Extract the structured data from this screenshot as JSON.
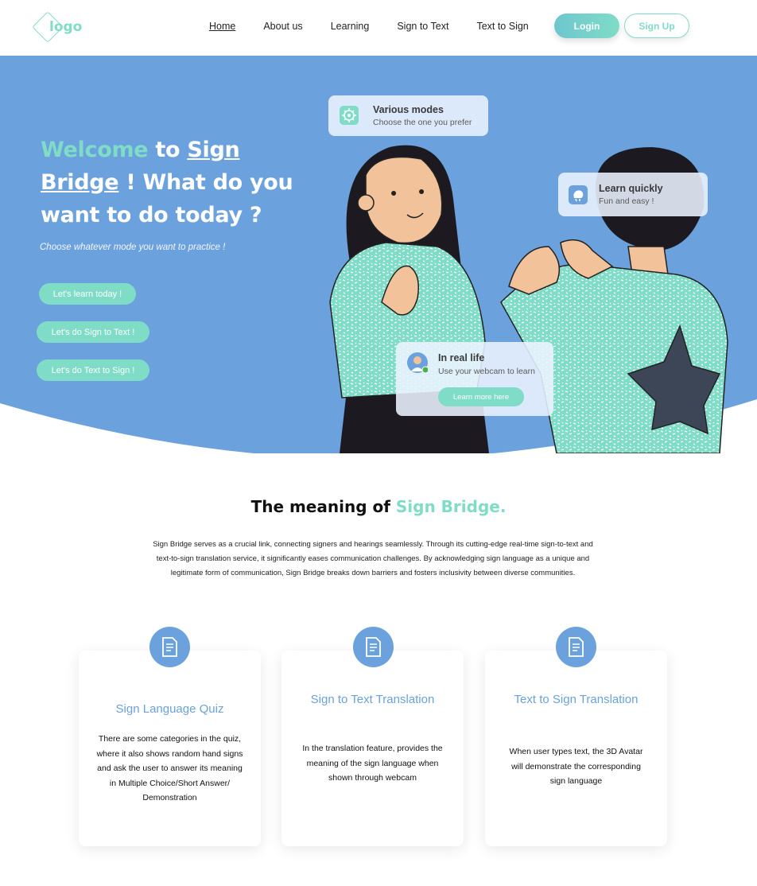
{
  "nav": {
    "logo_text": "logo",
    "links": [
      {
        "label": "Home",
        "active": true
      },
      {
        "label": "About us"
      },
      {
        "label": "Learning"
      },
      {
        "label": "Sign to Text"
      },
      {
        "label": "Text to Sign"
      }
    ],
    "login_label": "Login",
    "signup_label": "Sign Up"
  },
  "hero": {
    "title_welcome": "Welcome",
    "title_to": " to ",
    "title_sign": "Sign",
    "title_bridge": "Bridge",
    "title_rest": " ! What do you want to do today ?",
    "subtitle": "Choose whatever mode you want to practice !",
    "buttons": [
      "Let's learn today !",
      "Let's do Sign to Text !",
      "Let's do Text to Sign !"
    ],
    "cards": {
      "modes": {
        "title": "Various modes",
        "sub": "Choose the one you prefer",
        "icon": "gear-icon"
      },
      "learn": {
        "title": "Learn quickly",
        "sub": "Fun and easy !",
        "icon": "brain-icon"
      },
      "real": {
        "title": "In real life",
        "sub": "Use your webcam to learn",
        "button": "Learn more here",
        "icon": "user-avatar-icon"
      }
    }
  },
  "meaning": {
    "title_prefix": "The meaning of ",
    "title_accent": "Sign Bridge.",
    "text": "Sign Bridge serves as a crucial link, connecting signers and hearings seamlessly. Through its cutting-edge real-time sign-to-text and text-to-sign translation service, it significantly eases communication challenges. By acknowledging sign language as a unique and legitimate form of communication, Sign Bridge breaks down barriers and fosters inclusivity between diverse communities."
  },
  "features": [
    {
      "title": "Sign Language Quiz",
      "text": "There are some categories in the quiz, where it also shows random hand signs and ask the user to answer its meaning in Multiple Choice/Short Answer/ Demonstration",
      "icon": "document-icon"
    },
    {
      "title": "Sign to Text Translation",
      "text": "In the translation feature, provides the meaning of the sign language when shown through webcam",
      "icon": "document-icon"
    },
    {
      "title": "Text to Sign Translation",
      "text": "When user types text, the 3D Avatar will demonstrate the corresponding sign language",
      "icon": "document-icon"
    }
  ],
  "colors": {
    "accent": "#7fdcc6",
    "hero_bg": "#6ba1dc",
    "feature_title": "#6ba1dc"
  }
}
